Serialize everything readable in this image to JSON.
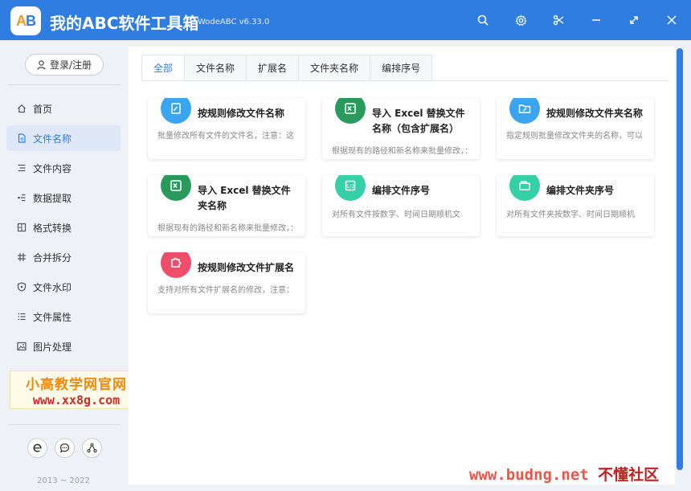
{
  "app": {
    "logo_text_a": "A",
    "logo_text_b": "B",
    "title": "我的ABC软件工具箱",
    "version": "WodeABC v6.33.0"
  },
  "titlebar_icons": [
    "search-icon",
    "gear-icon",
    "scissors-icon",
    "minimize-icon",
    "maximize-icon",
    "close-icon"
  ],
  "sidebar": {
    "login_label": "登录/注册",
    "items": [
      {
        "label": "首页",
        "icon": "home-icon",
        "active": false
      },
      {
        "label": "文件名称",
        "icon": "file-icon",
        "active": true
      },
      {
        "label": "文件内容",
        "icon": "list-icon",
        "active": false
      },
      {
        "label": "数据提取",
        "icon": "extract-icon",
        "active": false
      },
      {
        "label": "格式转换",
        "icon": "convert-icon",
        "active": false
      },
      {
        "label": "合并拆分",
        "icon": "hash-icon",
        "active": false
      },
      {
        "label": "文件水印",
        "icon": "shield-icon",
        "active": false
      },
      {
        "label": "文件属性",
        "icon": "properties-icon",
        "active": false
      },
      {
        "label": "图片处理",
        "icon": "image-icon",
        "active": false
      }
    ],
    "footer_icons": [
      "ie-icon",
      "chat-icon",
      "share-icon"
    ],
    "copyright": "2013 ~ 2022"
  },
  "watermark": {
    "line1": "小高教学网官网",
    "line2": "www.xx8g.com"
  },
  "tabs": [
    "全部",
    "文件名称",
    "扩展名",
    "文件夹名称",
    "编排序号"
  ],
  "active_tab": 0,
  "cards": [
    {
      "title": "按规则修改文件名称",
      "desc": "批量修改所有文件的文件名，注意：这",
      "icon": "edit-doc-icon",
      "color": "#3aa4ef"
    },
    {
      "title": "导入 Excel 替换文件名称（包含扩展名）",
      "desc": "根据现有的路径和新名称来批量修改，：",
      "icon": "excel-icon",
      "color": "#2a9a5c"
    },
    {
      "title": "按规则修改文件夹名称",
      "desc": "指定规则批量修改文件夹的名称，可以",
      "icon": "folder-edit-icon",
      "color": "#3aa4ef"
    },
    {
      "title": "导入 Excel 替换文件夹名称",
      "desc": "根据现有的路径和新名称来批量修改，：",
      "icon": "excel-icon",
      "color": "#2a9a5c"
    },
    {
      "title": "编排文件序号",
      "desc": "对所有文件按数字、时间日期顺机文",
      "icon": "sequence-icon",
      "color": "#35d0a8"
    },
    {
      "title": "编排文件夹序号",
      "desc": "对所有文件夹按数字、时间日期顺机",
      "icon": "folder-sequence-icon",
      "color": "#35d0a8"
    },
    {
      "title": "按规则修改文件扩展名",
      "desc": "支持对所有文件扩展名的修改，注意：",
      "icon": "puzzle-icon",
      "color": "#ef4e6a"
    }
  ],
  "corner_watermark": {
    "url": "www.budng.net",
    "site": "不懂社区"
  }
}
